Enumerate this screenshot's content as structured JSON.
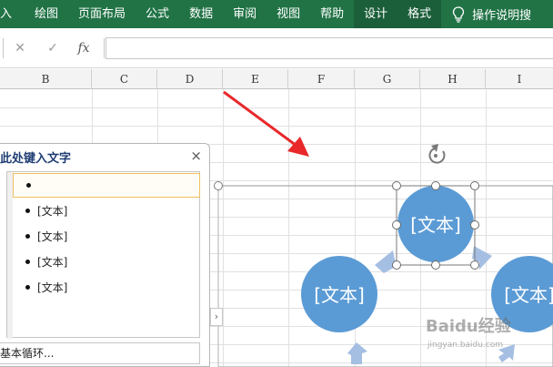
{
  "ribbon": {
    "tabs": [
      "入",
      "绘图",
      "页面布局",
      "公式",
      "数据",
      "审阅",
      "视图",
      "帮助",
      "设计",
      "格式"
    ],
    "tell_me": "操作说明搜",
    "tell_me_icon": "lightbulb-icon",
    "color": "#217346"
  },
  "formula_bar": {
    "cancel": "✕",
    "enter": "✓",
    "fx": "fx",
    "value": ""
  },
  "columns": [
    "B",
    "C",
    "D",
    "E",
    "F",
    "G",
    "H",
    "I"
  ],
  "text_pane": {
    "title": "此处键入文字",
    "close": "×",
    "items": [
      "",
      "[文本]",
      "[文本]",
      "[文本]",
      "[文本]"
    ],
    "footer": "基本循环..."
  },
  "smartart": {
    "shape_label": "[文本]",
    "circle_color": "#5b9bd5",
    "arrow_color": "#a5bfe3",
    "nodes": [
      "[文本]",
      "[文本]",
      "[文本]"
    ]
  },
  "watermark": {
    "brand": "Baidu经验",
    "url": "jingyan.baidu.com"
  },
  "annotation_color": "#e8282b"
}
